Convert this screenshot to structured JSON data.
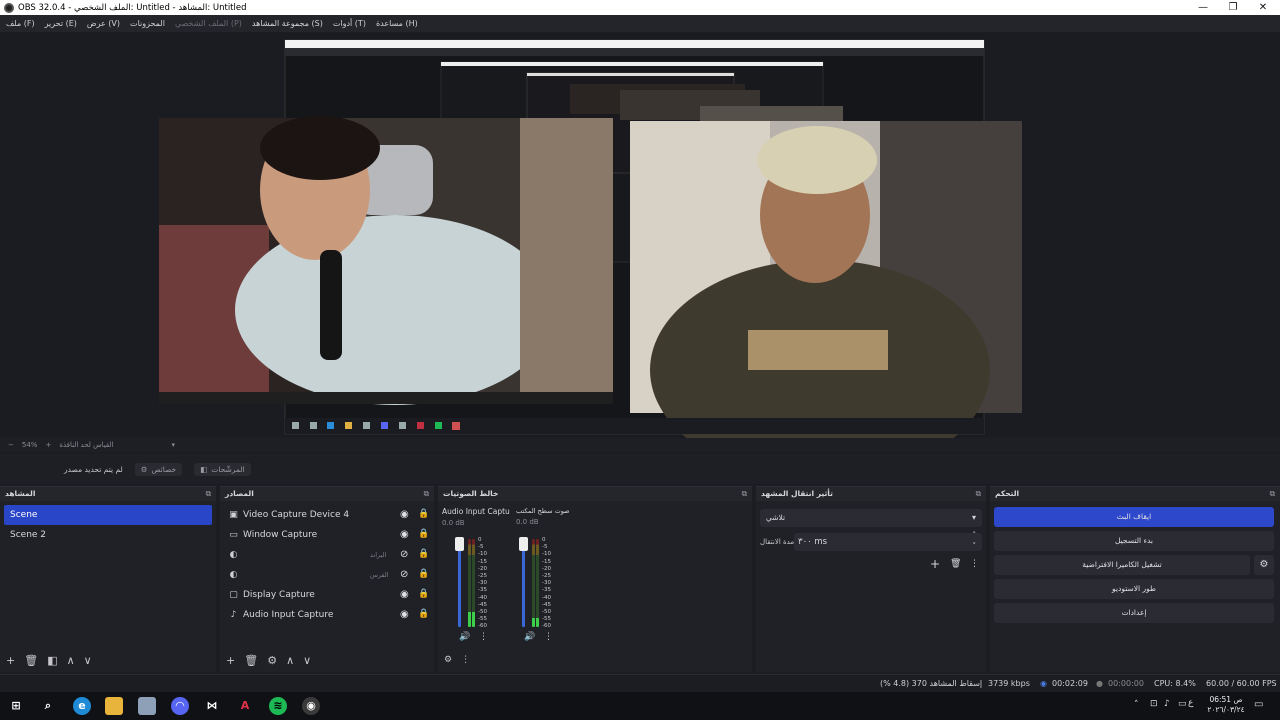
{
  "titlebar": {
    "title": "OBS 32.0.4 - الملف الشخصي: Untitled - المشاهد: Untitled",
    "minimize": "—",
    "maximize": "❐",
    "close": "✕"
  },
  "menu": [
    "ملف (F)",
    "تحرير (E)",
    "عرض (V)",
    "المحزونات",
    "الملف الشخصي (P)",
    "مجموعة المشاهد (S)",
    "أدوات (T)",
    "مساعدة (H)"
  ],
  "preview_toolbar": {
    "zoom": "54%",
    "plus": "+",
    "fit_label": "القياس لحد النافذة"
  },
  "context_bar": {
    "no_source": "لم يتم تحديد مصدر",
    "properties": "خصائص",
    "filters": "المرشّحات"
  },
  "scenes": {
    "title": "المشاهد",
    "items": [
      "Scene",
      "Scene 2"
    ],
    "selected": 0
  },
  "sources": {
    "title": "المصادر",
    "items": [
      {
        "name": "Video Capture Device 4",
        "icon": "camera-icon",
        "right_label": ""
      },
      {
        "name": "Window Capture",
        "icon": "window-icon",
        "right_label": ""
      },
      {
        "name": "",
        "icon": "browser-icon",
        "right_label": "البراند"
      },
      {
        "name": "",
        "icon": "browser-icon",
        "right_label": "الفرس"
      },
      {
        "name": "Display Capture",
        "icon": "monitor-icon",
        "right_label": ""
      },
      {
        "name": "Audio Input Capture",
        "icon": "mic-icon",
        "right_label": ""
      }
    ]
  },
  "mixer": {
    "title": "خالط الصوتيات",
    "channels": [
      {
        "name": "Audio Input Captu",
        "db": "0.0 dB",
        "level": 0.17
      },
      {
        "name": "صوت سطح المكتب",
        "db": "0.0 dB",
        "level": 0.1
      }
    ],
    "ticks": [
      "0",
      "-5",
      "-10",
      "-15",
      "-20",
      "-25",
      "-30",
      "-35",
      "-40",
      "-45",
      "-50",
      "-55",
      "-60"
    ]
  },
  "transitions": {
    "title": "تأثير انتقال المشهد",
    "type": "تلاشي",
    "duration_label": "مدة الانتقال",
    "duration_value": "٣٠٠ ms"
  },
  "controls": {
    "title": "التحكم",
    "buttons": [
      "ايقاف البث",
      "بدء التسجيل",
      "تشغيل الكاميرا الافتراضية",
      "طور الاستوديو",
      "إعدادات"
    ]
  },
  "status": {
    "dropped": "إسقاط المشاهد 370 (4.8 %)",
    "bitrate": "3739 kbps",
    "stream_time": "00:02:09",
    "rec_time": "00:00:00",
    "cpu": "CPU: 8.4%",
    "fps": "60.00 / 60.00 FPS"
  },
  "taskbar": {
    "time": "06:51 ص",
    "date": "٢٠٢٦/٠٣/٢٤",
    "lang": "ع"
  },
  "colors": {
    "accent": "#2e48cc",
    "panel": "#202127",
    "background": "#1c1d22"
  }
}
